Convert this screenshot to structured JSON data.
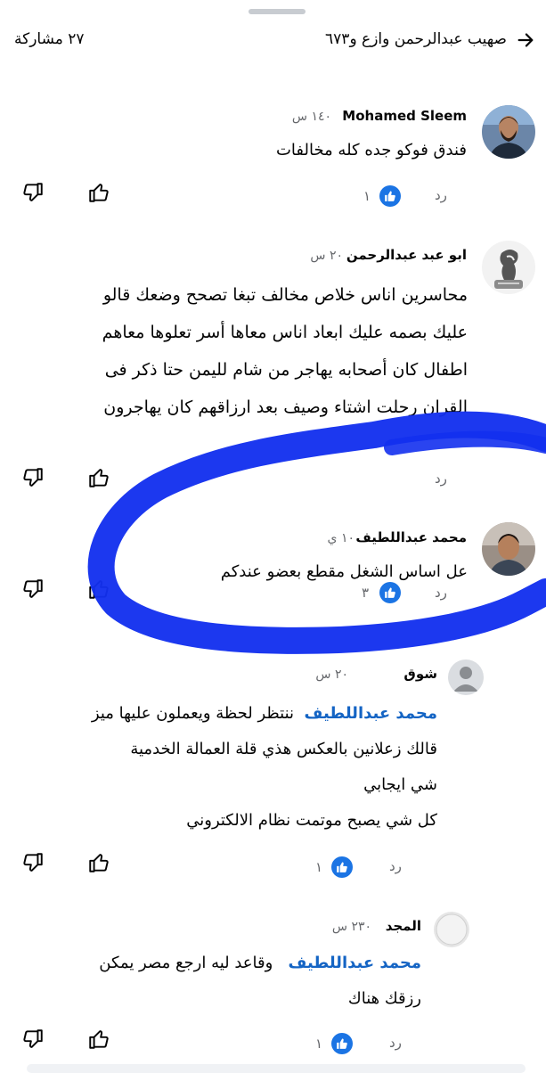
{
  "header": {
    "title": "صهيب عبدالرحمن وازع و٦٧٣",
    "shares": "٢٧ مشاركة"
  },
  "comments": [
    {
      "name": "Mohamed Sleem",
      "time": "١٤٠ س",
      "lines": [
        "فندق فوكو جده كله مخالفات"
      ],
      "reply": "رد",
      "likes": "١"
    },
    {
      "name": "ابو عبد عبدالرحمن",
      "time": "٢٠ س",
      "lines": [
        "محاسرين اناس خلاص  مخالف  تبغا تصحح وضعك قالو",
        "عليك بصمه عليك ابعاد  اناس معاها أسر تعلوها معاهم",
        "اطفال كان أصحابه يهاجر من شام لليمن حتا ذكر فى",
        "القران رحلت اشتاء وصيف  بعد ارزاقهم كان يهاجرون"
      ],
      "reply": "رد",
      "likes": ""
    },
    {
      "name": "محمد عبداللطيف",
      "time": "١٠ ي",
      "lines": [
        "عل اساس الشغل مقطع بعضو عندكم"
      ],
      "reply": "رد",
      "likes": "٣"
    },
    {
      "name": "شوق",
      "time": "٢٠ س",
      "mention": "محمد عبداللطيف",
      "first_rest": "ننتظر لحظة ويعملون عليها ميز",
      "lines": [
        "قالك زعلانين بالعكس هذي قلة العمالة الخدمية",
        "شي ايجابي",
        "كل شي يصبح موتمت نظام الالكتروني"
      ],
      "reply": "رد",
      "likes": "١"
    },
    {
      "name": "المجد",
      "time": "٢٣٠ س",
      "mention": "محمد عبداللطيف",
      "first_rest": "وقاعد ليه ارجع مصر يمكن",
      "lines": [
        "رزقك هناك"
      ],
      "reply": "رد",
      "likes": "١"
    }
  ],
  "colors": {
    "annotation_stroke": "#1330ee",
    "mention": "#1464c4",
    "like_badge": "#1b74e4",
    "secondary_text": "#65676b"
  },
  "icons": [
    "back-arrow-icon",
    "thumbs-up-icon",
    "thumbs-down-icon",
    "like-badge-icon",
    "default-avatar-icon"
  ]
}
